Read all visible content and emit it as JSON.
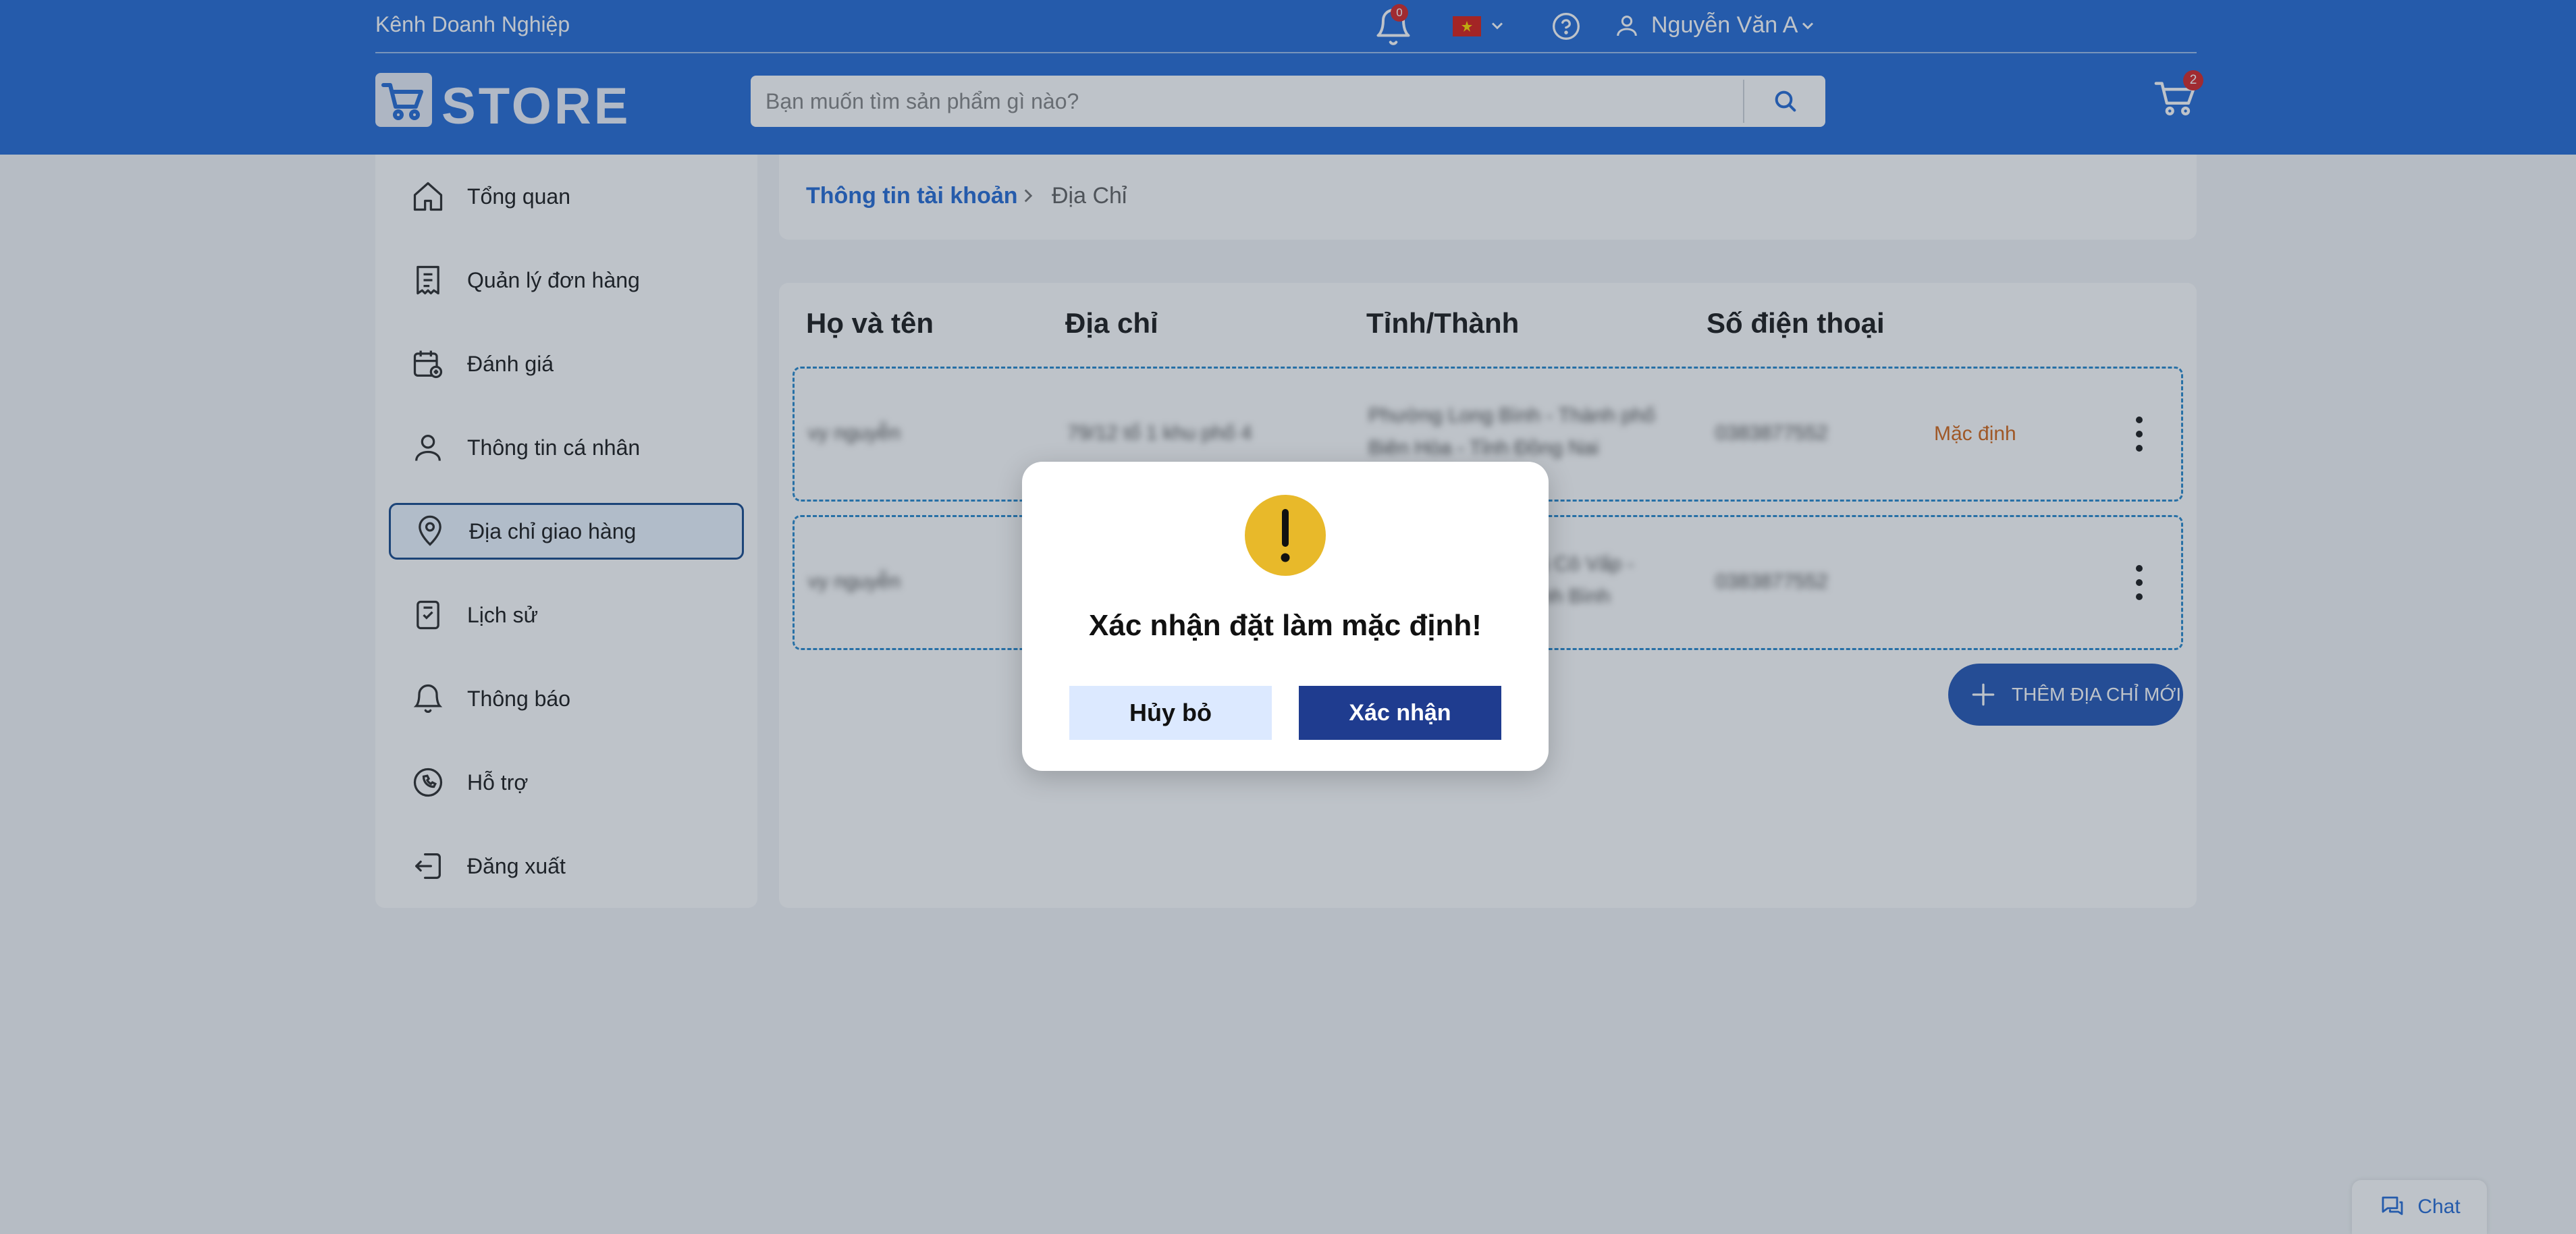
{
  "colors": {
    "header_bg": "#2b6fd6",
    "primary": "#2b6fd6",
    "confirm_button": "#1f3c8f",
    "cancel_button": "#dce9ff",
    "warning": "#e8b92a",
    "badge": "#d62d2d",
    "default_tag": "#d46b1f",
    "row_border": "#2f8ccf"
  },
  "header": {
    "business_link": "Kênh Doanh Nghiệp",
    "notification_count": "0",
    "language_flag": "vn-flag-icon",
    "user_name": "Nguyễn Văn A",
    "logo_text": "STORE",
    "search": {
      "placeholder": "Bạn muốn tìm sản phẩm gì nào?"
    },
    "cart_count": "2"
  },
  "sidebar": {
    "items": [
      {
        "label": "Tổng quan",
        "icon": "home-icon"
      },
      {
        "label": "Quản lý đơn hàng",
        "icon": "receipt-icon"
      },
      {
        "label": "Đánh giá",
        "icon": "calendar-review-icon"
      },
      {
        "label": "Thông tin cá nhân",
        "icon": "user-icon"
      },
      {
        "label": "Địa chỉ giao hàng",
        "icon": "location-pin-icon",
        "active": true
      },
      {
        "label": "Lịch sử",
        "icon": "history-icon"
      },
      {
        "label": "Thông báo",
        "icon": "bell-icon"
      },
      {
        "label": "Hỗ trợ",
        "icon": "phone-support-icon"
      },
      {
        "label": "Đăng xuất",
        "icon": "logout-icon"
      }
    ]
  },
  "breadcrumb": {
    "parent": "Thông tin tài khoản",
    "current": "Địa Chỉ"
  },
  "table": {
    "headers": [
      "Họ và tên",
      "Địa chỉ",
      "Tỉnh/Thành",
      "Số điện thoại"
    ],
    "rows": [
      {
        "name": "vy nguyễn",
        "address": "79/12 tổ 1 khu phố 4",
        "province": "Phường Long Bình - Thành phố Biên Hòa - Tỉnh Đồng Nai",
        "phone": "0383877552",
        "default_label": "Mặc định"
      },
      {
        "name": "vy nguyễn",
        "address": "",
        "province": "Xã Cô Vấp - Tỉnh Bình",
        "phone": "0383877552",
        "default_label": ""
      }
    ],
    "add_button": "THÊM ĐỊA CHỈ MỚI"
  },
  "chat": {
    "label": "Chat"
  },
  "modal": {
    "title": "Xác nhận đặt làm mặc định!",
    "cancel_label": "Hủy bỏ",
    "confirm_label": "Xác nhận"
  }
}
